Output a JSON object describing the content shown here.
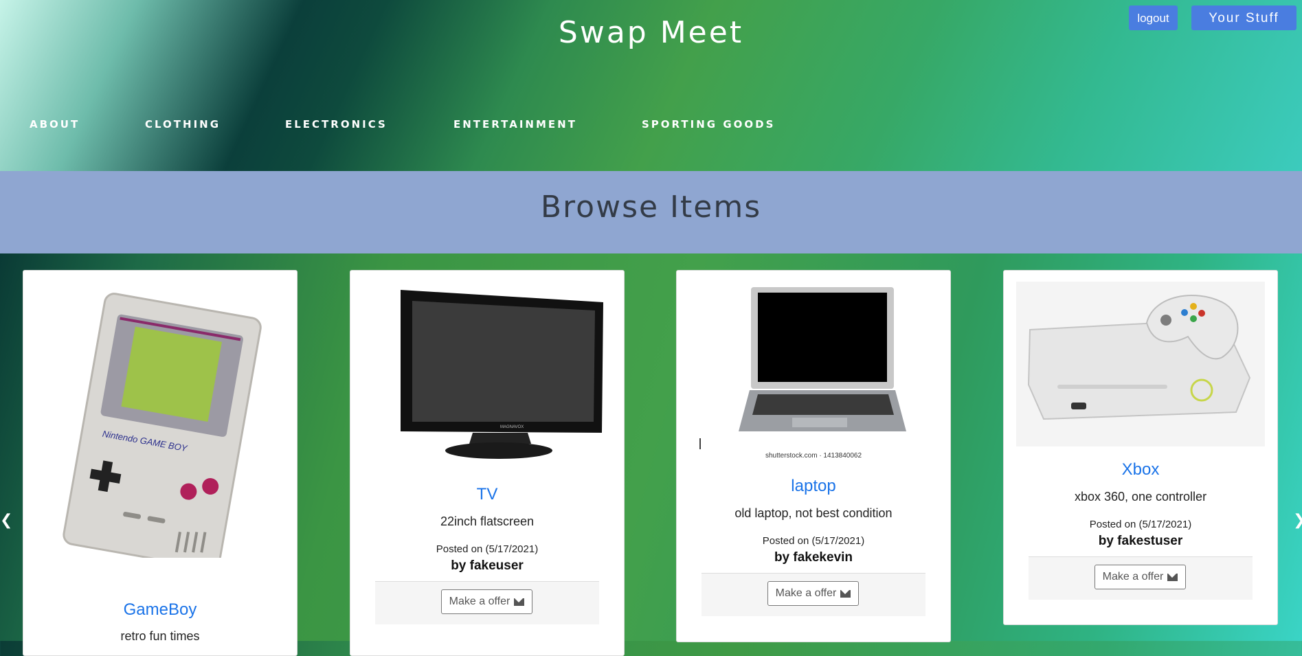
{
  "header": {
    "title": "Swap Meet",
    "logout_label": "logout",
    "your_stuff_label": "Your Stuff",
    "nav": [
      "ABOUT",
      "CLOTHING",
      "ELECTRONICS",
      "ENTERTAINMENT",
      "SPORTING GOODS"
    ]
  },
  "browse": {
    "title": "Browse Items"
  },
  "carousel": {
    "prev_icon": "chevron-left-icon",
    "next_icon": "chevron-right-icon"
  },
  "items": [
    {
      "name": "GameBoy",
      "description": "retro fun times",
      "image": "gameboy"
    },
    {
      "name": "TV",
      "description": "22inch flatscreen",
      "posted": "Posted on (5/17/2021)",
      "user": "by fakeuser",
      "offer_label": "Make a offer",
      "image": "tv"
    },
    {
      "name": "laptop",
      "description": "old laptop, not best condition",
      "posted": "Posted on (5/17/2021)",
      "user": "by fakekevin",
      "offer_label": "Make a offer",
      "image": "laptop",
      "watermark": "shutterstock.com · 1413840062"
    },
    {
      "name": "Xbox",
      "description": "xbox 360, one controller",
      "posted": "Posted on (5/17/2021)",
      "user": "by fakestuser",
      "offer_label": "Make a offer",
      "image": "xbox"
    }
  ]
}
